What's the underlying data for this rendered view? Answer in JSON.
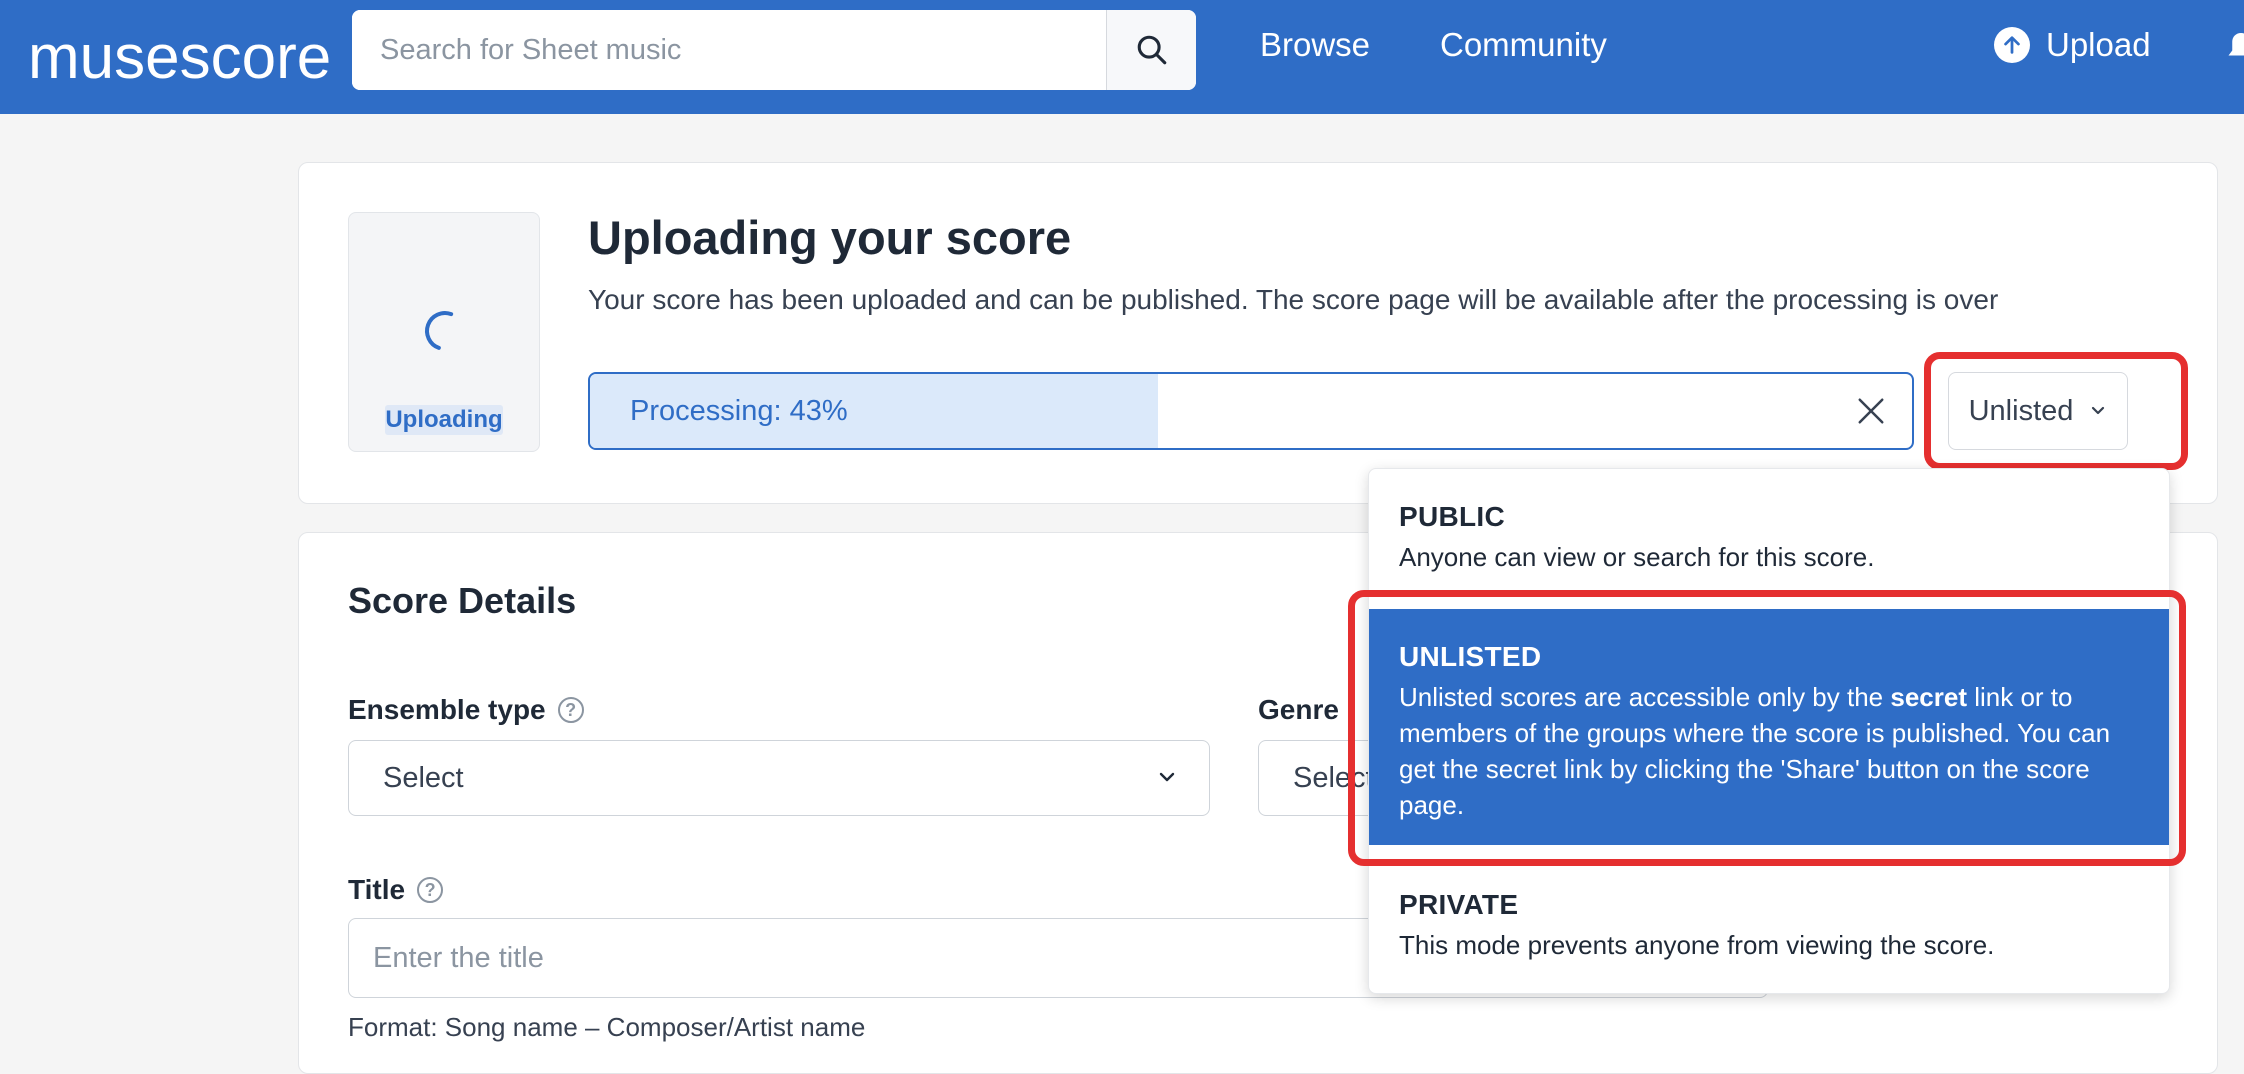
{
  "header": {
    "logo_text": "musescore",
    "search": {
      "placeholder": "Search for Sheet music",
      "value": "",
      "button_icon": "search-icon"
    },
    "nav": {
      "browse": "Browse",
      "community": "Community"
    },
    "upload_label": "Upload",
    "upload_icon": "arrow-up-circle-icon",
    "bell_icon": "bell-icon"
  },
  "upload_card": {
    "title": "Uploading your score",
    "subtitle": "Your score has been uploaded and can be published. The score page will be available after the processing is over",
    "thumbnail_status": "Uploading",
    "progress": {
      "label": "Processing: 43%",
      "value": 0.43
    },
    "visibility_selected": "Unlisted"
  },
  "visibility_menu": {
    "options": [
      {
        "title": "PUBLIC",
        "description": "Anyone can view or search for this score."
      },
      {
        "title": "UNLISTED",
        "desc_part1": "Unlisted scores are accessible only by the ",
        "desc_bold": "secret",
        "desc_part2": " link or to members of the groups where the score is published. You can get the secret link by clicking the 'Share' button on the score page.",
        "selected": true
      },
      {
        "title": "PRIVATE",
        "description": "This mode prevents anyone from viewing the score."
      }
    ]
  },
  "score_details": {
    "heading": "Score Details",
    "ensemble_type": {
      "label": "Ensemble type",
      "value": "Select"
    },
    "genre": {
      "label": "Genre",
      "value": "Select"
    },
    "title_field": {
      "label": "Title",
      "placeholder": "Enter the title",
      "hint": "Format: Song name – Composer/Artist name"
    }
  },
  "colors": {
    "brand": "#2f6dc6",
    "highlight": "#e52f2f",
    "progress_fill": "#dbe9fa"
  }
}
